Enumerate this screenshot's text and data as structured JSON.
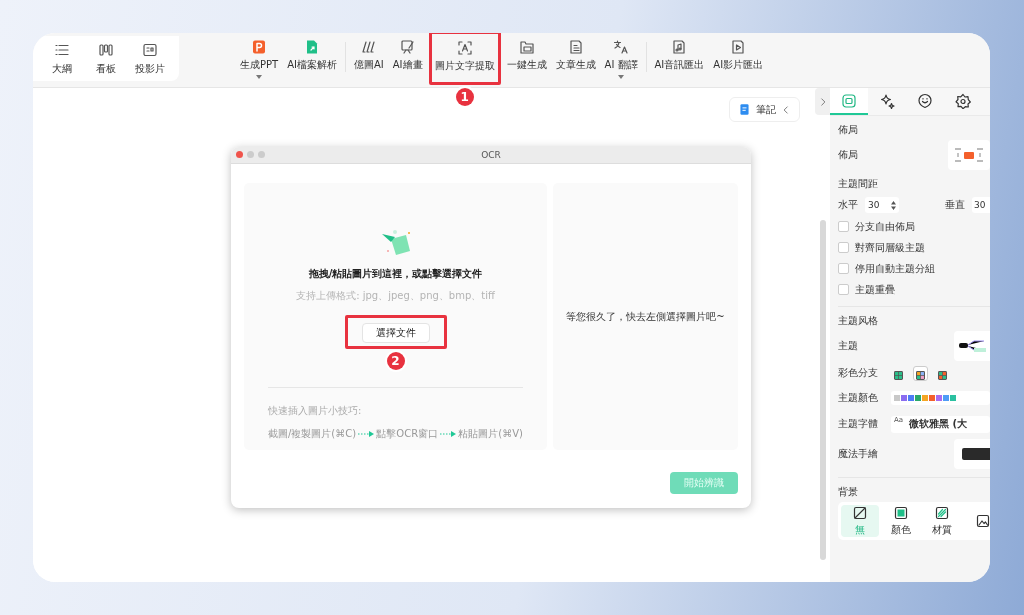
{
  "toolbar": {
    "view_modes": [
      {
        "label": "大綱",
        "kind": "outline"
      },
      {
        "label": "看板",
        "kind": "kanban"
      },
      {
        "label": "投影片",
        "kind": "slides"
      }
    ],
    "tool_groups": [
      {
        "tools": [
          {
            "label": "生成PPT",
            "kind": "ppt",
            "dropdown": true
          },
          {
            "label": "AI檔案解析",
            "kind": "docai",
            "dropdown": false
          }
        ]
      },
      {
        "tools": [
          {
            "label": "億圖AI",
            "kind": "strokes",
            "dropdown": false
          },
          {
            "label": "AI繪畫",
            "kind": "paint",
            "dropdown": false
          },
          {
            "label": "圖片文字提取",
            "kind": "scan",
            "dropdown": false,
            "callout": "1"
          },
          {
            "label": "一鍵生成",
            "kind": "stack",
            "dropdown": false
          },
          {
            "label": "文章生成",
            "kind": "article",
            "dropdown": false
          },
          {
            "label": "AI 翻譯",
            "kind": "translate",
            "dropdown": true
          }
        ]
      },
      {
        "tools": [
          {
            "label": "AI音訊匯出",
            "kind": "audio",
            "dropdown": false
          },
          {
            "label": "AI影片匯出",
            "kind": "video",
            "dropdown": false
          }
        ]
      }
    ]
  },
  "canvas": {
    "note_button": {
      "label": "筆記"
    }
  },
  "ocr_dialog": {
    "title": "OCR",
    "upload": {
      "title": "拖拽/粘貼圖片到這裡，或點擊選擇文件",
      "formats": "支持上傳格式: jpg、jpeg、png、bmp、tiff",
      "button": {
        "label": "選擇文件",
        "callout": "2"
      },
      "tips_title": "快速插入圖片小技巧:",
      "steps": [
        "截圖/複製圖片(⌘C)",
        "點擊OCR窗口",
        "粘貼圖片(⌘V)"
      ]
    },
    "result_placeholder": "等您很久了，快去左側選擇圖片吧~",
    "start_button": {
      "label": "開始辨識",
      "disabled": true
    }
  },
  "side_panel": {
    "tabs": [
      {
        "kind": "style",
        "selected": true
      },
      {
        "kind": "ai",
        "selected": false
      },
      {
        "kind": "icon",
        "selected": false
      },
      {
        "kind": "theme",
        "selected": false
      }
    ],
    "layout": {
      "heading": "佈局",
      "layout_label": "佈局",
      "spacing_label": "主題間距",
      "horizontal": {
        "label": "水平",
        "value": "30"
      },
      "vertical": {
        "label": "垂直",
        "value": "30"
      },
      "options": [
        {
          "label": "分支自由佈局",
          "checked": false
        },
        {
          "label": "對齊同層級主題",
          "checked": false
        },
        {
          "label": "停用自動主題分組",
          "checked": false
        },
        {
          "label": "主題重疊",
          "checked": false
        }
      ]
    },
    "topic_style": {
      "heading": "主題风格",
      "theme_label": "主題",
      "branch_label": "彩色分支",
      "branch_swatches": [
        {
          "selected": false
        },
        {
          "selected": true
        },
        {
          "selected": false
        }
      ],
      "color_label": "主題顏色",
      "font_label": "主題字體",
      "font_preview": "Aa",
      "font_value": "微软雅黑 (大",
      "hand_label": "魔法手繪"
    },
    "background": {
      "heading": "背景",
      "options": [
        {
          "label": "無",
          "kind": "none",
          "selected": true
        },
        {
          "label": "顏色",
          "kind": "color",
          "selected": false
        },
        {
          "label": "材質",
          "kind": "texture",
          "selected": false
        },
        {
          "kind": "image",
          "selected": false
        }
      ]
    }
  }
}
